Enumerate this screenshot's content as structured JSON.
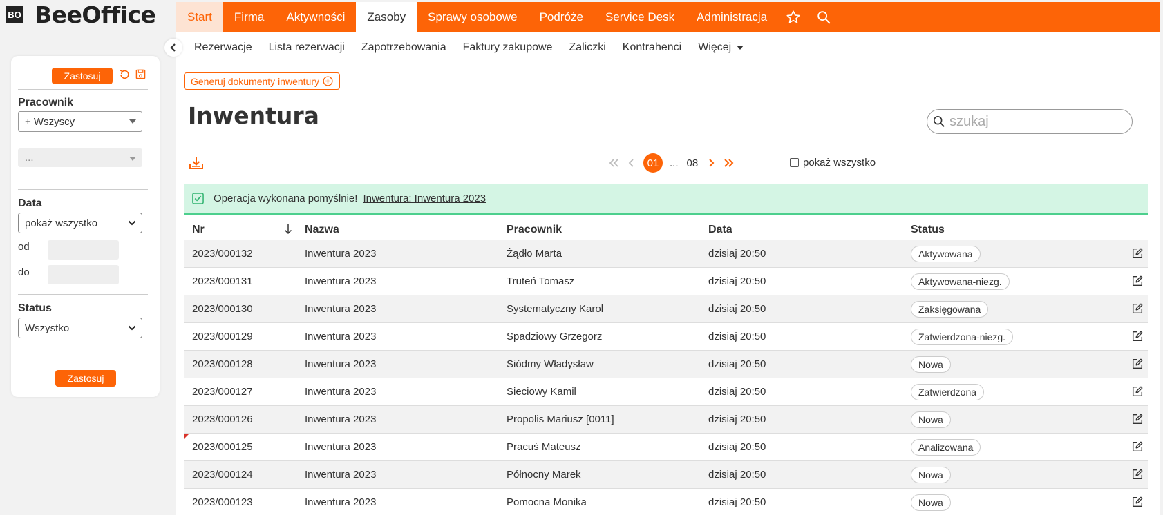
{
  "brand": {
    "logo_mark": "BO",
    "name": "BeeOffice"
  },
  "topnav": {
    "items": [
      "Start",
      "Firma",
      "Aktywności",
      "Zasoby",
      "Sprawy osobowe",
      "Podróże",
      "Service Desk",
      "Administracja"
    ],
    "active": "Zasoby",
    "icons": [
      "star-icon",
      "search-icon"
    ]
  },
  "subnav": {
    "items": [
      "Rezerwacje",
      "Lista rezerwacji",
      "Zapotrzebowania",
      "Faktury zakupowe",
      "Zaliczki",
      "Kontrahenci"
    ],
    "more_label": "Więcej"
  },
  "actions": {
    "generate_label": "Generuj dokumenty inwentury"
  },
  "page": {
    "title": "Inwentura"
  },
  "search": {
    "placeholder": "szukaj",
    "value": ""
  },
  "pagination": {
    "current": "01",
    "ellipsis": "...",
    "last": "08",
    "show_all_label": "pokaż wszystko"
  },
  "alert": {
    "message": "Operacja wykonana pomyślnie!",
    "link": "Inwentura: Inwentura 2023"
  },
  "table": {
    "headers": {
      "nr": "Nr",
      "name": "Nazwa",
      "employee": "Pracownik",
      "date": "Data",
      "status": "Status"
    },
    "rows": [
      {
        "nr": "2023/000132",
        "name": "Inwentura 2023",
        "employee": "Żądło Marta",
        "date": "dzisiaj 20:50",
        "status": "Aktywowana"
      },
      {
        "nr": "2023/000131",
        "name": "Inwentura 2023",
        "employee": "Truteń Tomasz",
        "date": "dzisiaj 20:50",
        "status": "Aktywowana-niezg."
      },
      {
        "nr": "2023/000130",
        "name": "Inwentura 2023",
        "employee": "Systematyczny Karol",
        "date": "dzisiaj 20:50",
        "status": "Zaksięgowana"
      },
      {
        "nr": "2023/000129",
        "name": "Inwentura 2023",
        "employee": "Spadziowy Grzegorz",
        "date": "dzisiaj 20:50",
        "status": "Zatwierdzona-niezg."
      },
      {
        "nr": "2023/000128",
        "name": "Inwentura 2023",
        "employee": "Siódmy Władysław",
        "date": "dzisiaj 20:50",
        "status": "Nowa"
      },
      {
        "nr": "2023/000127",
        "name": "Inwentura 2023",
        "employee": "Sieciowy Kamil",
        "date": "dzisiaj 20:50",
        "status": "Zatwierdzona"
      },
      {
        "nr": "2023/000126",
        "name": "Inwentura 2023",
        "employee": "Propolis Mariusz [0011]",
        "date": "dzisiaj 20:50",
        "status": "Nowa"
      },
      {
        "nr": "2023/000125",
        "name": "Inwentura 2023",
        "employee": "Pracuś Mateusz",
        "date": "dzisiaj 20:50",
        "status": "Analizowana"
      },
      {
        "nr": "2023/000124",
        "name": "Inwentura 2023",
        "employee": "Północny Marek",
        "date": "dzisiaj 20:50",
        "status": "Nowa"
      },
      {
        "nr": "2023/000123",
        "name": "Inwentura 2023",
        "employee": "Pomocna Monika",
        "date": "dzisiaj 20:50",
        "status": "Nowa"
      }
    ]
  },
  "filters": {
    "apply_label": "Zastosuj",
    "employee_label": "Pracownik",
    "employee_value": "+ Wszyscy",
    "employee_sub_value": "...",
    "date_label": "Data",
    "date_value": "pokaż wszystko",
    "from_label": "od",
    "to_label": "do",
    "status_label": "Status",
    "status_value": "Wszystko"
  },
  "colors": {
    "accent": "#fd6407",
    "success_bg": "#d4f5e4",
    "success_border": "#4ccf8d"
  }
}
